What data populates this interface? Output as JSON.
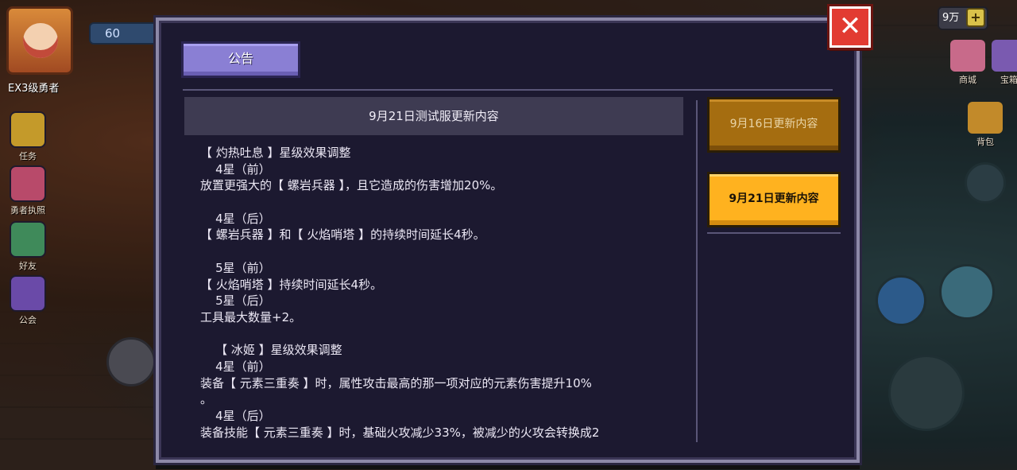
{
  "hud": {
    "level_label": "EX3级勇者",
    "energy_value": "60",
    "left_menu": [
      {
        "label": "任务"
      },
      {
        "label": "勇者执照"
      },
      {
        "label": "好友"
      },
      {
        "label": "公会"
      }
    ],
    "coin_value": "9万",
    "plus_label": "+",
    "shop_label": "商城",
    "chest_label": "宝箱",
    "bag_label": "背包"
  },
  "dialog": {
    "tab_label": "公告",
    "close_label": "✕",
    "content_title": "9月21日测试服更新内容",
    "lines": [
      "【 灼热吐息 】星级效果调整",
      "    4星（前）",
      "放置更强大的【 螺岩兵器 】，且它造成的伤害增加20%。",
      "",
      "    4星（后）",
      "【 螺岩兵器 】和【 火焰哨塔 】的持续时间延长4秒。",
      "",
      "    5星（前）",
      "【 火焰哨塔 】持续时间延长4秒。",
      "    5星（后）",
      "工具最大数量+2。",
      "",
      "    【 冰姬 】星级效果调整",
      "    4星（前）",
      "装备【 元素三重奏 】时，属性攻击最高的那一项对应的元素伤害提升10%",
      "。",
      "    4星（后）",
      "装备技能【 元素三重奏 】时，基础火攻减少33%，被减少的火攻会转换成2"
    ],
    "side_items": [
      {
        "label": "9月16日更新内容",
        "state": "inactive"
      },
      {
        "label": "9月21日更新内容",
        "state": "active"
      }
    ]
  },
  "colors": {
    "dialog_bg": "#1c1930",
    "tab_purple": "#8a7fd4",
    "active_orange": "#ffb21f",
    "inactive_orange": "#a56d10",
    "close_red": "#e23b32"
  }
}
